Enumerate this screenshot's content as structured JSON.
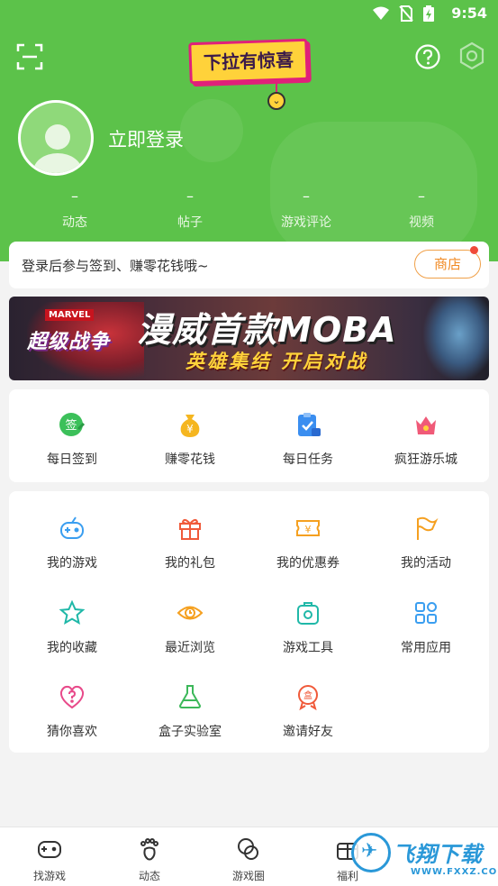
{
  "status_bar": {
    "time": "9:54"
  },
  "header": {
    "pull_banner": "下拉有惊喜",
    "login_text": "立即登录",
    "stats": [
      {
        "value": "–",
        "label": "动态"
      },
      {
        "value": "–",
        "label": "帖子"
      },
      {
        "value": "–",
        "label": "游戏评论"
      },
      {
        "value": "–",
        "label": "视频"
      }
    ]
  },
  "signin": {
    "text": "登录后参与签到、赚零花钱哦~",
    "shop_label": "商店"
  },
  "banner": {
    "brand": "MARVEL",
    "game_name": "超级战争",
    "title": "漫威首款MOBA",
    "subtitle": "英雄集结 开启对战"
  },
  "quick": [
    {
      "label": "每日签到",
      "icon": "签",
      "color": "#3cc05a"
    },
    {
      "label": "赚零花钱",
      "icon": "¥",
      "color": "#f5b620"
    },
    {
      "label": "每日任务",
      "icon": "✓",
      "color": "#3a8ef0"
    },
    {
      "label": "疯狂游乐城",
      "icon": "♛",
      "color": "#f05a78"
    }
  ],
  "my_grid": [
    {
      "label": "我的游戏",
      "color": "#3a9ef0"
    },
    {
      "label": "我的礼包",
      "color": "#f05a3a"
    },
    {
      "label": "我的优惠券",
      "color": "#f5a020"
    },
    {
      "label": "我的活动",
      "color": "#f5a020"
    },
    {
      "label": "我的收藏",
      "color": "#20b8a8"
    },
    {
      "label": "最近浏览",
      "color": "#f5a020"
    },
    {
      "label": "游戏工具",
      "color": "#20b8a8"
    },
    {
      "label": "常用应用",
      "color": "#3a9ef0"
    },
    {
      "label": "猜你喜欢",
      "color": "#e84a8a"
    },
    {
      "label": "盒子实验室",
      "color": "#3cb85a"
    },
    {
      "label": "邀请好友",
      "color": "#f05a3a"
    }
  ],
  "bottom_nav": [
    {
      "label": "找游戏"
    },
    {
      "label": "动态"
    },
    {
      "label": "游戏圈"
    },
    {
      "label": "福利"
    }
  ],
  "watermark": {
    "title": "飞翔下载",
    "url": "WWW.FXXZ.COM"
  }
}
